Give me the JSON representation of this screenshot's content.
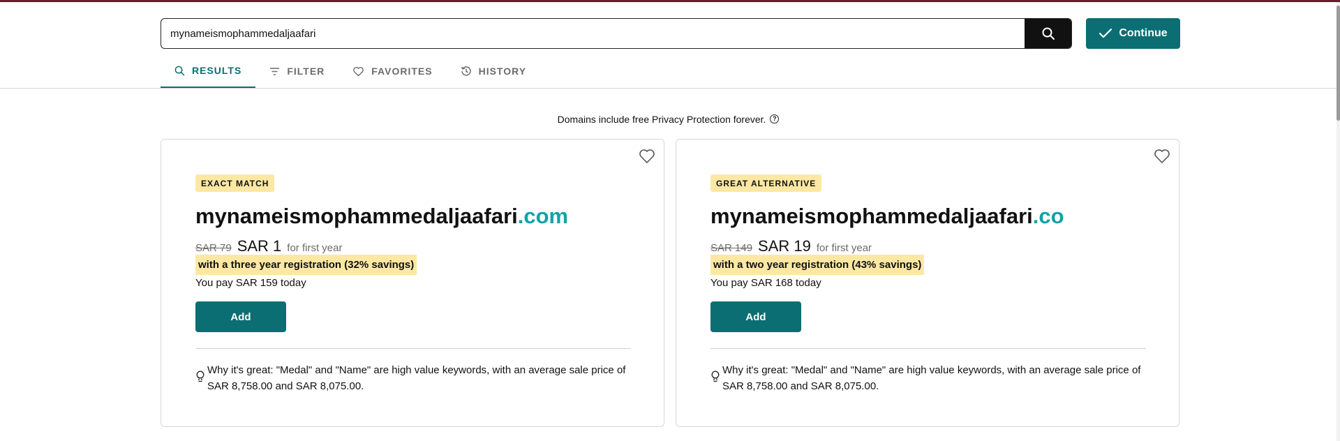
{
  "search": {
    "value": "mynameismophammedaljaafari",
    "placeholder": ""
  },
  "continue_label": "Continue",
  "tabs": [
    {
      "label": "RESULTS",
      "icon": "search-icon",
      "active": true
    },
    {
      "label": "FILTER",
      "icon": "filter-icon",
      "active": false
    },
    {
      "label": "FAVORITES",
      "icon": "heart-icon",
      "active": false
    },
    {
      "label": "HISTORY",
      "icon": "history-icon",
      "active": false
    }
  ],
  "privacy_note": "Domains include free Privacy Protection forever.",
  "results": [
    {
      "badge": "EXACT MATCH",
      "name": "mynameismophammedaljaafari",
      "tld": ".com",
      "old_price": "SAR 79",
      "new_price": "SAR 1",
      "per_year": "for first year",
      "savings": "with a three year registration (32% savings)",
      "pay_today": "You pay SAR 159 today",
      "add_label": "Add",
      "why": "Why it's great: \"Medal\" and \"Name\" are high value keywords, with an average sale price of SAR 8,758.00 and SAR 8,075.00."
    },
    {
      "badge": "GREAT ALTERNATIVE",
      "name": "mynameismophammedaljaafari",
      "tld": ".co",
      "old_price": "SAR 149",
      "new_price": "SAR 19",
      "per_year": "for first year",
      "savings": "with a two year registration (43% savings)",
      "pay_today": "You pay SAR 168 today",
      "add_label": "Add",
      "why": "Why it's great: \"Medal\" and \"Name\" are high value keywords, with an average sale price of SAR 8,758.00 and SAR 8,075.00."
    }
  ],
  "colors": {
    "accent": "#0b6e72",
    "tld": "#0fa3a8",
    "highlight": "#fce8a3",
    "top_bar": "#6e1a2a"
  }
}
